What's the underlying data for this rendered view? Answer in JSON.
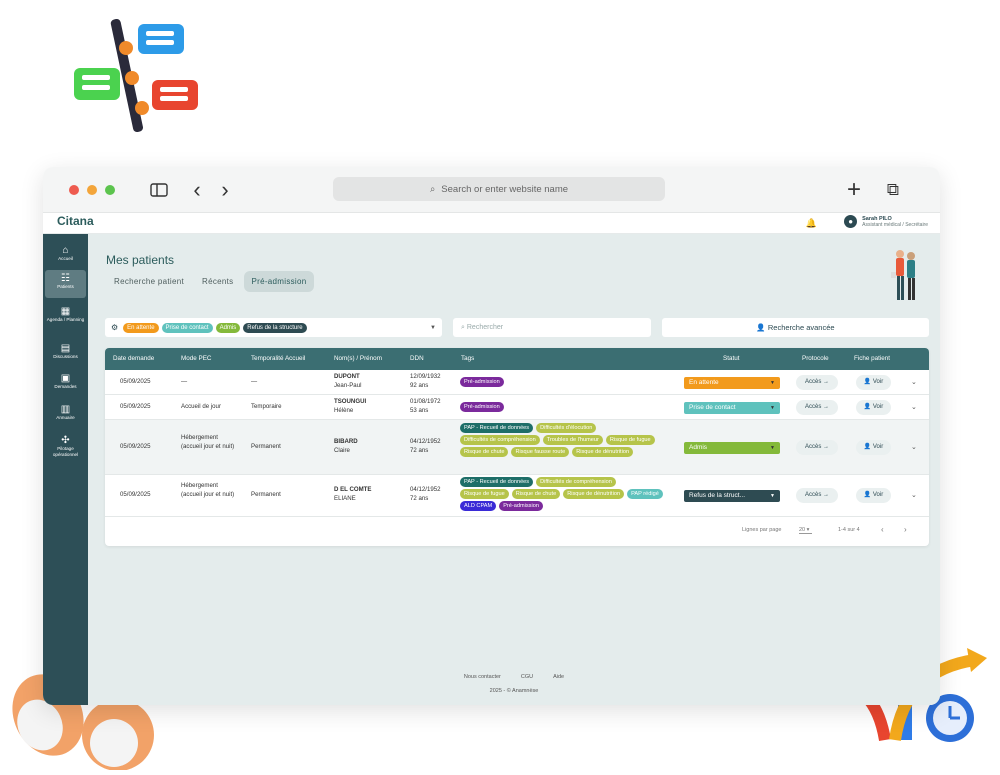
{
  "browser": {
    "url_placeholder": "Search or enter website name",
    "nav_back": "‹",
    "nav_forward": "›",
    "new_tab": "+",
    "tabs_icon": "⧉"
  },
  "app": {
    "logo": "Citana",
    "user_name": "Sarah PILO",
    "user_role": "Assistant médical / Secrétaire"
  },
  "sidebar": {
    "items": [
      {
        "label": "Accueil",
        "icon": "⌂"
      },
      {
        "label": "Patients",
        "icon": "☷"
      },
      {
        "label": "Agenda / Planning",
        "icon": "▦"
      },
      {
        "label": "Discussions",
        "icon": "▤"
      },
      {
        "label": "Demandes",
        "icon": "▣"
      },
      {
        "label": "Annuaire",
        "icon": "▥"
      },
      {
        "label": "Pilotage opérationnel",
        "icon": "✣"
      }
    ]
  },
  "page": {
    "title": "Mes patients",
    "tabs": [
      "Recherche patient",
      "Récents",
      "Pré-admission"
    ]
  },
  "filters": {
    "chips": [
      {
        "label": "En attente",
        "color": "#f29a1c"
      },
      {
        "label": "Prise de contact",
        "color": "#5fc2bd"
      },
      {
        "label": "Admis",
        "color": "#84b93a"
      },
      {
        "label": "Refus de la structure",
        "color": "#2e4b52"
      }
    ],
    "search_placeholder": "Rechercher",
    "advanced_search": "Recherche avancée"
  },
  "table": {
    "headers": [
      "Date demande",
      "Mode PEC",
      "Temporalité Accueil",
      "Nom(s) / Prénom",
      "DDN",
      "Tags",
      "Statut",
      "Protocole",
      "Fiche patient"
    ],
    "rows": [
      {
        "date": "05/09/2025",
        "mode": "—",
        "temporalite": "—",
        "nom": "DUPONT",
        "prenom": "Jean-Paul",
        "ddn": "12/09/1932",
        "age": "92 ans",
        "tags": [
          {
            "label": "Pré-admission",
            "color": "#7b2a9c"
          }
        ],
        "statut": "En attente",
        "statut_color": "#f29a1c",
        "protocole": "Accès →",
        "fiche": "Voir"
      },
      {
        "date": "05/09/2025",
        "mode": "Accueil de jour",
        "temporalite": "Temporaire",
        "nom": "TSOUNGUI",
        "prenom": "Hélène",
        "ddn": "01/08/1972",
        "age": "53 ans",
        "tags": [
          {
            "label": "Pré-admission",
            "color": "#7b2a9c"
          }
        ],
        "statut": "Prise de contact",
        "statut_color": "#5fc2bd",
        "protocole": "Accès →",
        "fiche": "Voir"
      },
      {
        "date": "05/09/2025",
        "mode": "Hébergement (accueil jour et nuit)",
        "temporalite": "Permanent",
        "nom": "BIBARD",
        "prenom": "Claire",
        "ddn": "04/12/1952",
        "age": "72 ans",
        "tags": [
          {
            "label": "PAP - Recueil de données",
            "color": "#1e6e68"
          },
          {
            "label": "Difficultés d'élocution",
            "color": "#b6c44a"
          },
          {
            "label": "Difficultés de compréhension",
            "color": "#b6c44a"
          },
          {
            "label": "Troubles de l'humeur",
            "color": "#b6c44a"
          },
          {
            "label": "Risque de fugue",
            "color": "#b6c44a"
          },
          {
            "label": "Risque de chute",
            "color": "#b6c44a"
          },
          {
            "label": "Risque fausse route",
            "color": "#b6c44a"
          },
          {
            "label": "Risque de dénutrition",
            "color": "#b6c44a"
          }
        ],
        "statut": "Admis",
        "statut_color": "#84b93a",
        "protocole": "Accès →",
        "fiche": "Voir"
      },
      {
        "date": "05/09/2025",
        "mode": "Hébergement (accueil jour et nuit)",
        "temporalite": "Permanent",
        "nom": "D EL COMTE",
        "prenom": "ELIANE",
        "ddn": "04/12/1952",
        "age": "72 ans",
        "tags": [
          {
            "label": "PAP - Recueil de données",
            "color": "#1e6e68"
          },
          {
            "label": "Difficultés de compréhension",
            "color": "#b6c44a"
          },
          {
            "label": "Risque de fugue",
            "color": "#b6c44a"
          },
          {
            "label": "Risque de chute",
            "color": "#b6c44a"
          },
          {
            "label": "Risque de dénutrition",
            "color": "#b6c44a"
          },
          {
            "label": "PAP rédigé",
            "color": "#5fc2bd"
          },
          {
            "label": "ALD CPAM",
            "color": "#3a2bd6"
          },
          {
            "label": "Pré-admission",
            "color": "#7b2a9c"
          }
        ],
        "statut": "Refus de la struct...",
        "statut_color": "#2e4b52",
        "protocole": "Accès →",
        "fiche": "Voir"
      }
    ],
    "pager": {
      "lines_label": "Lignes par page",
      "lines_value": "20",
      "range": "1-4 sur 4"
    }
  },
  "footer": {
    "links": [
      "Nous contacter",
      "CGU",
      "Aide"
    ],
    "copyright": "2025 - © Anamnèse"
  }
}
